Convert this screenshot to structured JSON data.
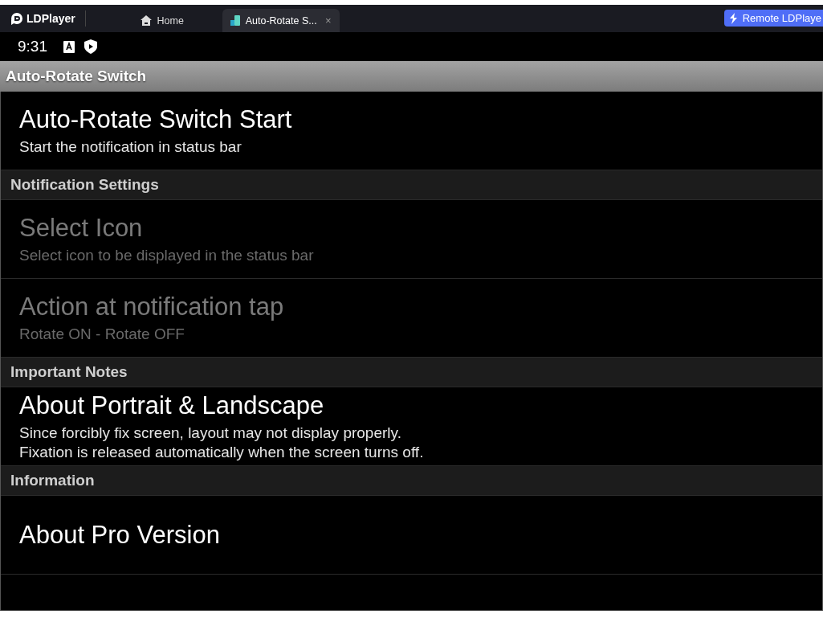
{
  "emulator": {
    "brand": "LDPlayer",
    "tabs": [
      {
        "label": "Home",
        "selected": false
      },
      {
        "label": "Auto-Rotate S...",
        "selected": true,
        "close": "×"
      }
    ],
    "remote_button": "Remote LDPlaye"
  },
  "status_bar": {
    "time": "9:31"
  },
  "action_bar": {
    "title": "Auto-Rotate Switch"
  },
  "preferences": [
    {
      "kind": "item",
      "title": "Auto-Rotate Switch Start",
      "summary": "Start the notification in status bar",
      "disabled": false
    },
    {
      "kind": "category",
      "title": "Notification Settings"
    },
    {
      "kind": "item",
      "title": "Select Icon",
      "summary": "Select icon to be displayed in the status bar",
      "disabled": true
    },
    {
      "kind": "item",
      "title": "Action at notification tap",
      "summary": "Rotate ON - Rotate OFF",
      "disabled": true
    },
    {
      "kind": "category",
      "title": "Important Notes"
    },
    {
      "kind": "item",
      "title": "About Portrait & Landscape",
      "summary": "Since forcibly fix screen, layout may not display properly.\nFixation is released automatically when the screen turns off.",
      "disabled": false
    },
    {
      "kind": "category",
      "title": "Information"
    },
    {
      "kind": "item",
      "title": "About Pro Version",
      "disabled": false
    }
  ]
}
